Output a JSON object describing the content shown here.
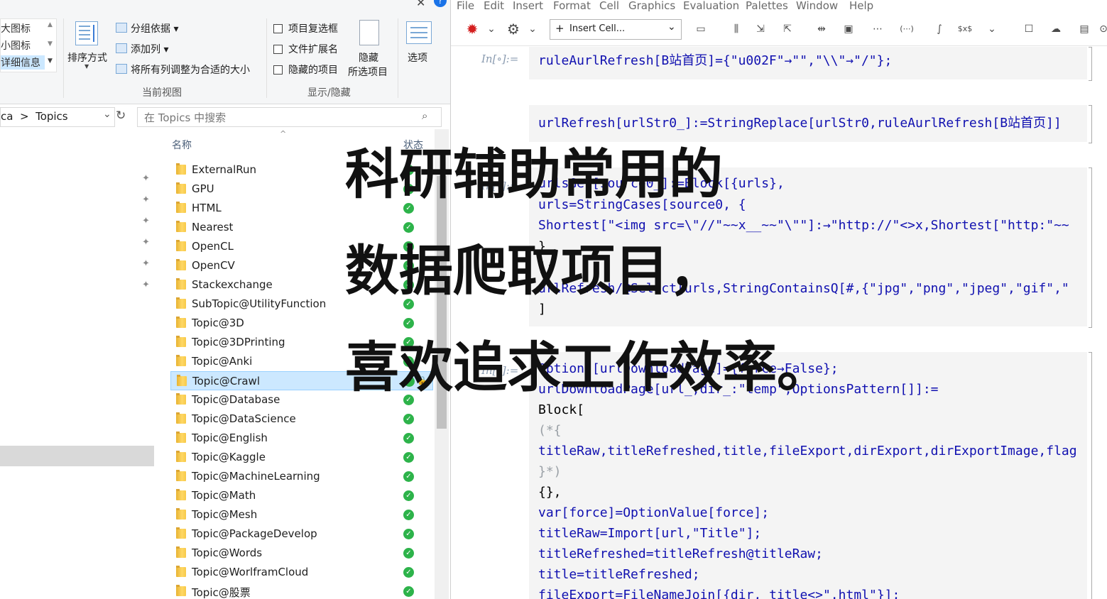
{
  "explorer": {
    "layout_list": [
      "大图标",
      "小图标",
      "详细信息"
    ],
    "sort_label": "排序方式",
    "group_by": "分组依据",
    "add_column": "添加列",
    "fit_columns": "将所有列调整为合适的大小",
    "current_view_group": "当前视图",
    "item_checkboxes": "项目复选框",
    "file_extensions": "文件扩展名",
    "hidden_items": "隐藏的项目",
    "hide_selected_line1": "隐藏",
    "hide_selected_line2": "所选项目",
    "options": "选项",
    "show_hide_group": "显示/隐藏",
    "address": "ca  >  Topics",
    "search_placeholder": "在 Topics 中搜索",
    "col_name": "名称",
    "col_status": "状态",
    "files": [
      "ExternalRun",
      "GPU",
      "HTML",
      "Nearest",
      "OpenCL",
      "OpenCV",
      "Stackexchange",
      "SubTopic@UtilityFunction",
      "Topic@3D",
      "Topic@3DPrinting",
      "Topic@Anki",
      "Topic@Crawl",
      "Topic@Database",
      "Topic@DataScience",
      "Topic@English",
      "Topic@Kaggle",
      "Topic@MachineLearning",
      "Topic@Math",
      "Topic@Mesh",
      "Topic@PackageDevelop",
      "Topic@Words",
      "Topic@WorlframCloud",
      "Topic@股票"
    ],
    "selected_file": "Topic@Crawl",
    "status_color": "#2db34a"
  },
  "mma": {
    "menus": [
      "File",
      "Edit",
      "Insert",
      "Format",
      "Cell",
      "Graphics",
      "Evaluation",
      "Palettes",
      "Window",
      "Help"
    ],
    "insert_cell_label": "Insert Cell...",
    "in_label": "In[∘]:=",
    "cell1": "ruleAurlRefresh[B站首页]={\"u002F\"→\"\",\"\\\\\"→\"/\"};",
    "cell2": "urlRefresh[urlStr0_]:=StringReplace[urlStr0,ruleAurlRefresh[B站首页]]",
    "cell3": [
      "urlsGet[source0_]:=Block[{urls},",
      "urls=StringCases[source0, {",
      "Shortest[\"<img src=\\\"//\"~~x__~~\"\\\"\"]:→\"http://\"<>x,Shortest[\"http:\"~~",
      "}",
      "];",
      "urlRefresh/@Select[urls,StringContainsQ[#,{\"jpg\",\"png\",\"jpeg\",\"gif\",\"",
      "]"
    ],
    "cell4": [
      "Options[urlDownloadPage]={force→False};",
      "urlDownloadPage[url_,dir_:\"temp\",OptionsPattern[]]:=",
      "Block[",
      "(*{",
      "titleRaw,titleRefreshed,title,fileExport,dirExport,dirExportImage,flag",
      "}*)",
      "{},",
      "var[force]=OptionValue[force];",
      "titleRaw=Import[url,\"Title\"];",
      "titleRefreshed=titleRefresh@titleRaw;",
      "title=titleRefreshed;",
      "fileExport=FileNameJoin[{dir, title<>\".html\"}];"
    ]
  },
  "overlay": {
    "lines": [
      "科研辅助常用的",
      "数据爬取项目，",
      "喜欢追求工作效率。"
    ]
  }
}
